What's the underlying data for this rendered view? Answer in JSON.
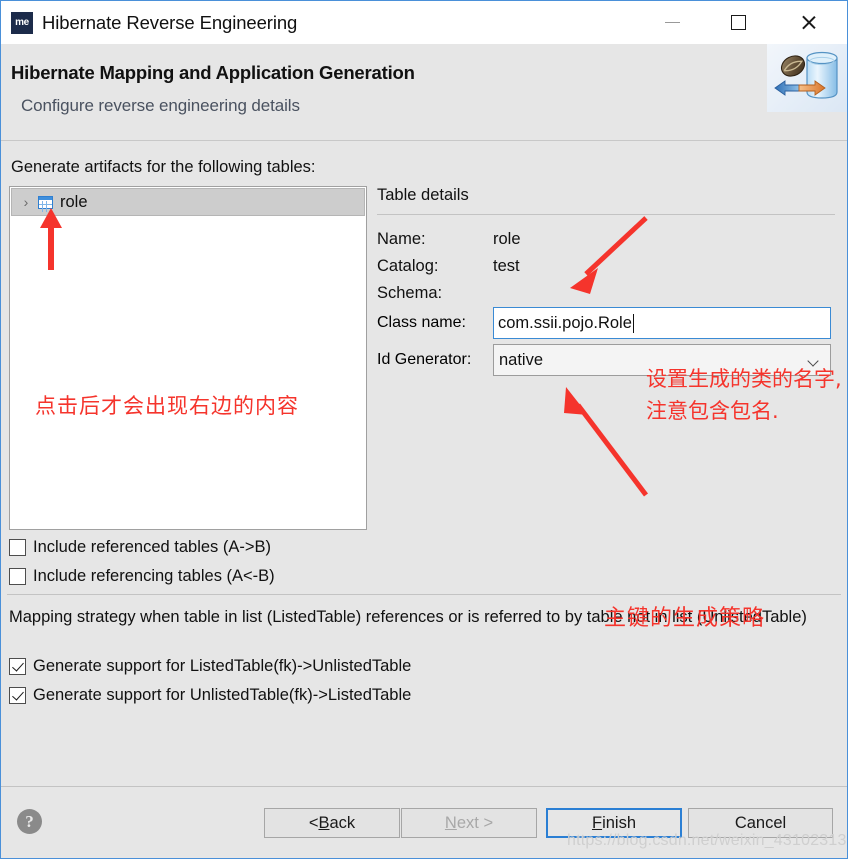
{
  "window": {
    "title": "Hibernate Reverse Engineering",
    "app_icon_text": "me",
    "minimize_label": "Minimize",
    "maximize_label": "Maximize",
    "close_label": "Close"
  },
  "header": {
    "title": "Hibernate Mapping and Application Generation",
    "subtitle": "Configure reverse engineering details"
  },
  "main": {
    "generate_label": "Generate artifacts for the following tables:",
    "table_list": [
      {
        "name": "role",
        "expander": "›",
        "icon": "table-grid-icon",
        "selected": true
      }
    ],
    "checkboxes": [
      {
        "label": "Include referenced tables (A->B)",
        "checked": false
      },
      {
        "label": "Include referencing tables (A<-B)",
        "checked": false
      }
    ],
    "mapping_strategy_description": "Mapping strategy when table in list (ListedTable) references or is referred to by table not in list (UnlistedTable)",
    "mapping_checkboxes": [
      {
        "label": "Generate support for ListedTable(fk)->UnlistedTable",
        "checked": true
      },
      {
        "label": "Generate support for UnlistedTable(fk)->ListedTable",
        "checked": true
      }
    ]
  },
  "details": {
    "title": "Table details",
    "name_label": "Name:",
    "name_value": "role",
    "catalog_label": "Catalog:",
    "catalog_value": "test",
    "schema_label": "Schema:",
    "schema_value": "",
    "class_name_label": "Class name:",
    "class_name_value": "com.ssii.pojo.Role",
    "id_generator_label": "Id Generator:",
    "id_generator_value": "native"
  },
  "annotations": {
    "left_note": "点击后才会出现右边的内容",
    "class_note": "设置生成的类的名字, 注意包含包名.",
    "idgen_note": "主键的生成策略",
    "color": "#f5342c"
  },
  "footer": {
    "help_label": "?",
    "buttons": [
      {
        "id": "back",
        "prefix": "< ",
        "mnemonic": "B",
        "suffix": "ack",
        "disabled": false,
        "focused": false
      },
      {
        "id": "next",
        "prefix": "",
        "mnemonic": "N",
        "suffix": "ext >",
        "disabled": true,
        "focused": false
      },
      {
        "id": "finish",
        "prefix": "",
        "mnemonic": "F",
        "suffix": "inish",
        "disabled": false,
        "focused": true
      },
      {
        "id": "cancel",
        "prefix": "",
        "mnemonic": "",
        "suffix": "Cancel",
        "disabled": false,
        "focused": false
      }
    ]
  },
  "watermark": "https://blog.csdn.net/weixin_43102313"
}
